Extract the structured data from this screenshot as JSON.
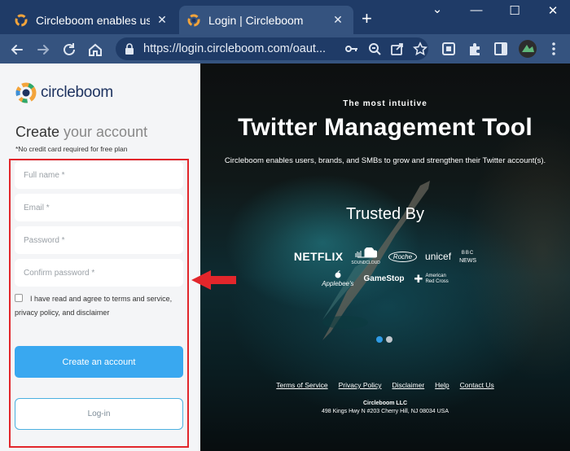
{
  "browser": {
    "tabs": [
      {
        "title": "Circleboom enables users, b",
        "active": false
      },
      {
        "title": "Login | Circleboom",
        "active": true
      }
    ],
    "new_tab": "+",
    "window_controls": {
      "collapse": "⌄",
      "minimize": "—",
      "maximize": "☐",
      "close": "✕"
    },
    "url": "https://login.circleboom.com/oaut...",
    "icons": [
      "back-icon",
      "forward-icon",
      "reload-icon",
      "home-icon",
      "lock-icon",
      "key-icon",
      "zoom-icon",
      "share-icon",
      "bookmark-star-icon",
      "extension-icon",
      "puzzle-icon",
      "sidebar-icon",
      "profile-avatar-icon",
      "menu-dots-icon"
    ]
  },
  "form": {
    "brand": "circleboom",
    "heading_strong": "Create",
    "heading_light": " your account",
    "note": "*No credit card required for free plan",
    "fields": {
      "full_name": "Full name *",
      "email": "Email *",
      "password": "Password *",
      "confirm": "Confirm password *"
    },
    "agree_prefix": "I have read and agree to ",
    "agree_terms": "terms and service,",
    "agree_line2": "privacy policy, and disclaimer",
    "create_button": "Create an account",
    "login_button": "Log-in"
  },
  "hero": {
    "tagline": "The most intuitive",
    "headline": "Twitter Management Tool",
    "subtitle": "Circleboom enables users, brands, and SMBs to grow and strengthen their Twitter account(s).",
    "trusted_by": "Trusted By",
    "logos": {
      "netflix": "NETFLIX",
      "soundcloud": "SOUNDCLOUD",
      "roche": "Roche",
      "unicef": "unicef",
      "bbc_top": "BBC",
      "bbc_bottom": "NEWS",
      "applebees": "Applebee's",
      "gamestop": "GameStop",
      "redcross_1": "American",
      "redcross_2": "Red Cross"
    },
    "footer_links": [
      "Terms of Service",
      "Privacy Policy",
      "Disclaimer",
      "Help",
      "Contact Us"
    ],
    "company": "Circleboom LLC",
    "address": "498 Kings Hwy N #203 Cherry Hill, NJ 08034 USA"
  },
  "colors": {
    "tabbar": "#1f3b67",
    "toolbar": "#35537f",
    "annotation_red": "#e2262b",
    "primary_button": "#39a8f0"
  }
}
